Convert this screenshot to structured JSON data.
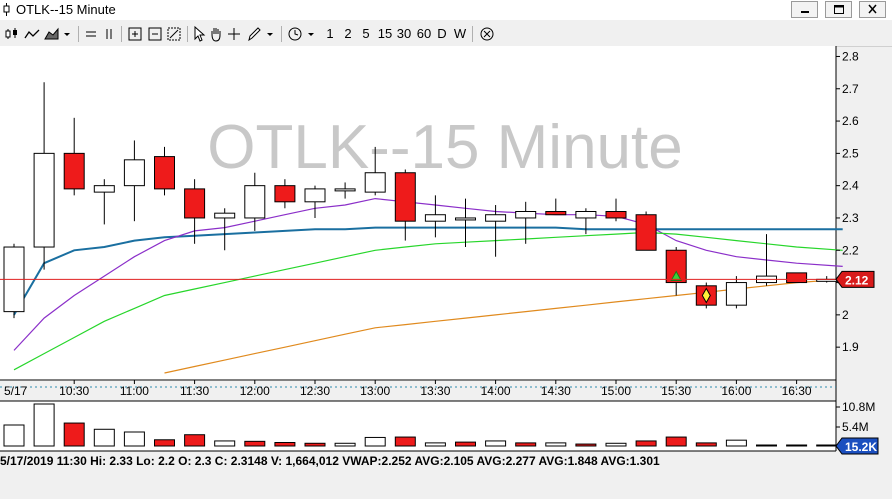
{
  "window": {
    "title": "OTLK--15 Minute"
  },
  "toolbar": {
    "periods": [
      "1",
      "2",
      "5",
      "15",
      "30",
      "60",
      "D",
      "W"
    ]
  },
  "chart_data": {
    "type": "candlestick",
    "watermark": "OTLK--15 Minute",
    "ylim": [
      1.82,
      2.82
    ],
    "y_ticks": [
      "2.8",
      "2.7",
      "2.6",
      "2.5",
      "2.4",
      "2.3",
      "2.2",
      "2.1",
      "2",
      "1.9"
    ],
    "date_label": "5/17",
    "time_labels": [
      "10:30",
      "11:00",
      "11:30",
      "12:00",
      "12:30",
      "13:00",
      "13:30",
      "14:00",
      "14:30",
      "15:00",
      "15:30",
      "16:00",
      "16:30"
    ],
    "last_price": "2.12",
    "last_price_value": 2.11,
    "candles": [
      {
        "o": 2.01,
        "h": 2.22,
        "l": 1.99,
        "c": 2.21
      },
      {
        "o": 2.21,
        "h": 2.72,
        "l": 2.14,
        "c": 2.5
      },
      {
        "o": 2.5,
        "h": 2.61,
        "l": 2.37,
        "c": 2.39
      },
      {
        "o": 2.38,
        "h": 2.42,
        "l": 2.28,
        "c": 2.4
      },
      {
        "o": 2.4,
        "h": 2.54,
        "l": 2.29,
        "c": 2.48
      },
      {
        "o": 2.49,
        "h": 2.52,
        "l": 2.37,
        "c": 2.39
      },
      {
        "o": 2.39,
        "h": 2.42,
        "l": 2.22,
        "c": 2.3
      },
      {
        "o": 2.3,
        "h": 2.33,
        "l": 2.2,
        "c": 2.3148
      },
      {
        "o": 2.3,
        "h": 2.44,
        "l": 2.26,
        "c": 2.4
      },
      {
        "o": 2.4,
        "h": 2.42,
        "l": 2.33,
        "c": 2.35
      },
      {
        "o": 2.35,
        "h": 2.4,
        "l": 2.3,
        "c": 2.39
      },
      {
        "o": 2.39,
        "h": 2.41,
        "l": 2.36,
        "c": 2.39
      },
      {
        "o": 2.38,
        "h": 2.52,
        "l": 2.37,
        "c": 2.44
      },
      {
        "o": 2.44,
        "h": 2.45,
        "l": 2.23,
        "c": 2.29
      },
      {
        "o": 2.29,
        "h": 2.37,
        "l": 2.24,
        "c": 2.31
      },
      {
        "o": 2.3,
        "h": 2.36,
        "l": 2.21,
        "c": 2.3
      },
      {
        "o": 2.29,
        "h": 2.34,
        "l": 2.18,
        "c": 2.31
      },
      {
        "o": 2.3,
        "h": 2.35,
        "l": 2.22,
        "c": 2.32
      },
      {
        "o": 2.32,
        "h": 2.36,
        "l": 2.31,
        "c": 2.31
      },
      {
        "o": 2.3,
        "h": 2.33,
        "l": 2.25,
        "c": 2.32
      },
      {
        "o": 2.32,
        "h": 2.36,
        "l": 2.29,
        "c": 2.3
      },
      {
        "o": 2.31,
        "h": 2.32,
        "l": 2.2,
        "c": 2.2
      },
      {
        "o": 2.2,
        "h": 2.21,
        "l": 2.06,
        "c": 2.1
      },
      {
        "o": 2.09,
        "h": 2.1,
        "l": 2.02,
        "c": 2.03
      },
      {
        "o": 2.03,
        "h": 2.12,
        "l": 2.02,
        "c": 2.1
      },
      {
        "o": 2.1,
        "h": 2.25,
        "l": 2.09,
        "c": 2.12
      },
      {
        "o": 2.13,
        "h": 2.13,
        "l": 2.1,
        "c": 2.1
      },
      {
        "o": 2.11,
        "h": 2.12,
        "l": 2.1,
        "c": 2.11
      }
    ],
    "up_arrow_candle": 22,
    "diamond_candle": 23,
    "series": [
      {
        "color": "#1a6fa0",
        "values": [
          2.0,
          2.16,
          2.2,
          2.21,
          2.23,
          2.24,
          2.245,
          2.25,
          2.255,
          2.26,
          2.265,
          2.265,
          2.27,
          2.27,
          2.27,
          2.27,
          2.27,
          2.27,
          2.27,
          2.265,
          2.265,
          2.265,
          2.265,
          2.265,
          2.265,
          2.265,
          2.265,
          2.265
        ]
      },
      {
        "color": "#8b2fc9",
        "values": [
          1.89,
          1.99,
          2.06,
          2.12,
          2.18,
          2.23,
          2.26,
          2.27,
          2.29,
          2.31,
          2.33,
          2.34,
          2.36,
          2.35,
          2.34,
          2.33,
          2.32,
          2.315,
          2.31,
          2.31,
          2.305,
          2.28,
          2.23,
          2.2,
          2.18,
          2.17,
          2.16,
          2.15
        ]
      },
      {
        "color": "#27d62b",
        "values": [
          1.83,
          1.88,
          1.93,
          1.98,
          2.02,
          2.06,
          2.08,
          2.1,
          2.12,
          2.14,
          2.16,
          2.18,
          2.2,
          2.21,
          2.22,
          2.225,
          2.23,
          2.235,
          2.24,
          2.245,
          2.25,
          2.255,
          2.25,
          2.24,
          2.23,
          2.22,
          2.21,
          2.2
        ]
      },
      {
        "color": "#e08a1e",
        "values": [
          null,
          null,
          null,
          null,
          null,
          1.82,
          1.84,
          1.86,
          1.88,
          1.9,
          1.92,
          1.94,
          1.96,
          1.97,
          1.98,
          1.99,
          2.0,
          2.01,
          2.02,
          2.03,
          2.04,
          2.05,
          2.06,
          2.07,
          2.08,
          2.09,
          2.1,
          2.11
        ]
      }
    ],
    "volume": {
      "ticks": [
        "10.8M",
        "5.4M"
      ],
      "last": "15.2K",
      "max": 10800000,
      "values": [
        5400000,
        10800000,
        5900000,
        4300000,
        3600000,
        1600000,
        2900000,
        1300000,
        1200000,
        900000,
        700000,
        700000,
        2200000,
        2300000,
        800000,
        1000000,
        1300000,
        800000,
        800000,
        500000,
        700000,
        1300000,
        2300000,
        800000,
        1500000,
        100000,
        100000,
        100000
      ],
      "down": [
        false,
        false,
        true,
        false,
        false,
        true,
        true,
        false,
        true,
        true,
        true,
        false,
        false,
        true,
        false,
        true,
        false,
        true,
        false,
        true,
        false,
        true,
        true,
        true,
        false,
        false,
        false,
        false
      ]
    }
  },
  "status": {
    "text": "5/17/2019 11:30  Hi: 2.33  Lo: 2.2  O: 2.3  C: 2.3148  V: 1,664,012 VWAP:2.252 AVG:2.105 AVG:2.277 AVG:1.848 AVG:1.301"
  }
}
